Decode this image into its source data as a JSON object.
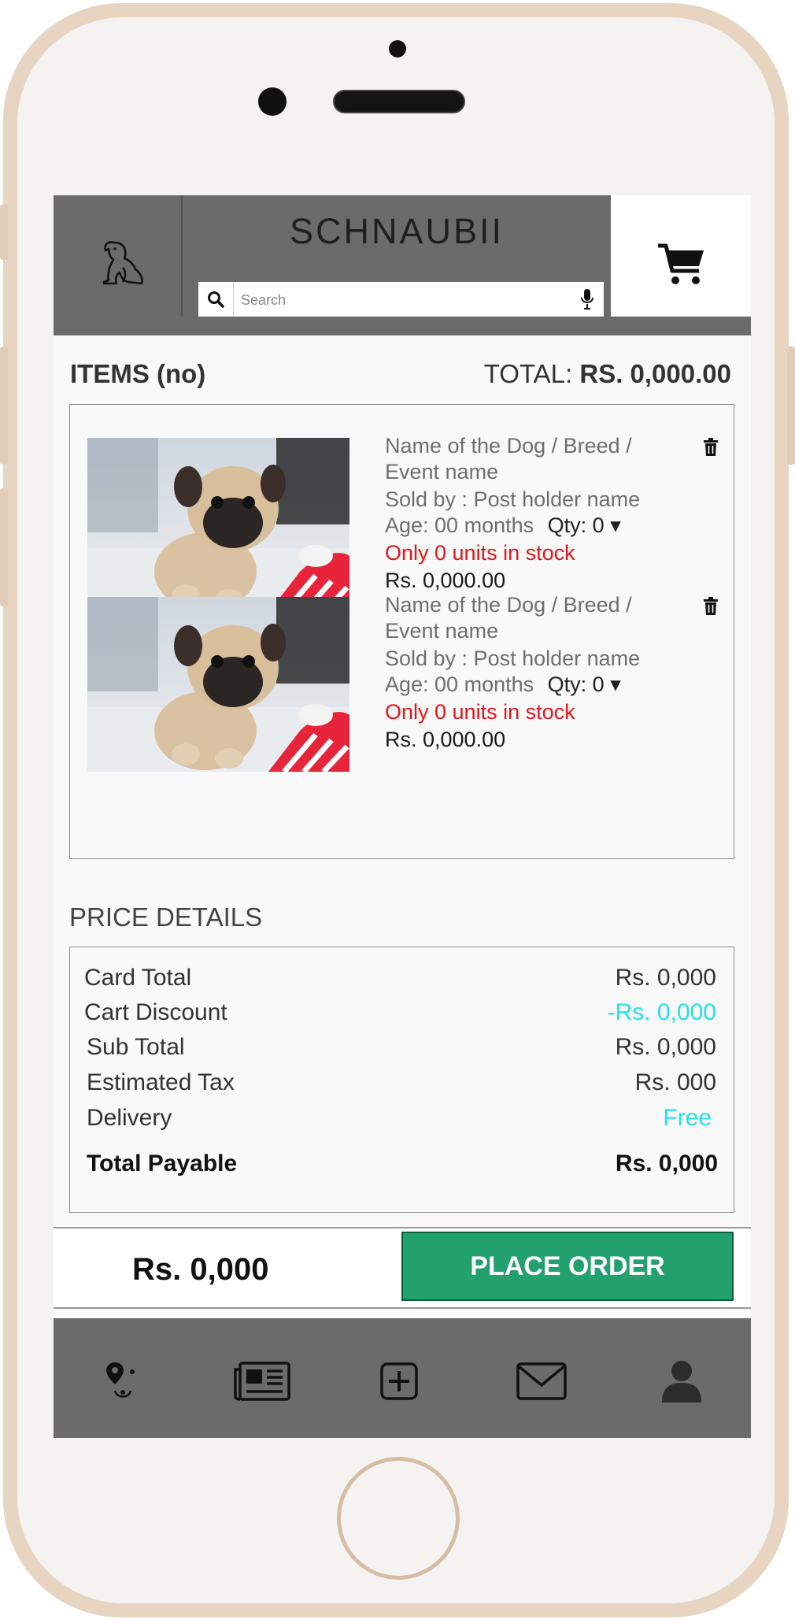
{
  "header": {
    "brand": "SCHNAUBII",
    "search_placeholder": "Search",
    "logo_icon": "dog-icon",
    "cart_icon": "cart-icon"
  },
  "summary": {
    "items_label": "ITEMS (no)",
    "total_prefix": "TOTAL: ",
    "total_value": "RS. 0,000.00"
  },
  "items": [
    {
      "name": "Name of the Dog / Breed /",
      "name_line2": "Event name",
      "seller": "Sold by : Post holder name",
      "age": "Age: 00 months",
      "qty": "Qty: 0",
      "stock": "Only 0 units in stock",
      "price": "Rs. 0,000.00"
    },
    {
      "name": "Name of the Dog / Breed /",
      "name_line2": "Event name",
      "seller": "Sold by : Post holder name",
      "age": "Age: 00 months",
      "qty": "Qty: 0",
      "stock": "Only 0 units in stock",
      "price": "Rs. 0,000.00"
    }
  ],
  "price_details": {
    "title": "PRICE DETAILS",
    "rows": [
      {
        "label": "Card Total",
        "value": "Rs. 0,000"
      },
      {
        "label": "Cart Discount",
        "value": "-Rs. 0,000"
      },
      {
        "label": "Sub Total",
        "value": "Rs. 0,000"
      },
      {
        "label": "Estimated Tax",
        "value": "Rs. 000"
      },
      {
        "label": "Delivery",
        "value": "Free"
      },
      {
        "label": "Total Payable",
        "value": "Rs. 0,000"
      }
    ]
  },
  "order": {
    "total": "Rs. 0,000",
    "button_label": "PLACE ORDER"
  },
  "colors": {
    "accent_green": "#22a06e",
    "header_gray": "#6b6b6b",
    "stock_red": "#e0161b",
    "discount_cyan": "#22e0ea"
  },
  "bottom_nav": [
    "dog-location-icon",
    "news-icon",
    "add-icon",
    "mail-icon",
    "profile-icon"
  ]
}
